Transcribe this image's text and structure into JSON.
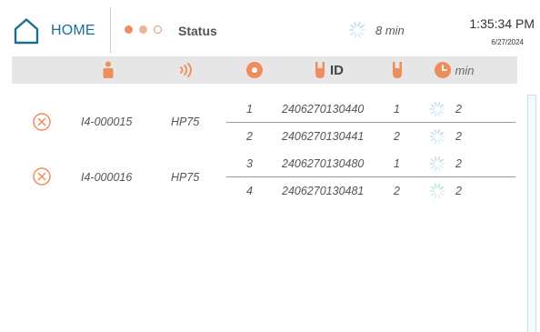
{
  "header": {
    "home_label": "HOME",
    "status_label": "Status",
    "status_dots": [
      "#ef8d5c",
      "#f2b394",
      "outline"
    ],
    "timer_text": "8 min",
    "clock_time": "1:35:34 PM",
    "clock_date": "6/27/2024"
  },
  "table_header": {
    "columns": [
      "person-icon",
      "rfid-signal-icon",
      "rack-position-icon",
      "tube-id-icon",
      "tube-icon",
      "clock-icon"
    ],
    "id_label": "ID",
    "min_label": "min"
  },
  "groups": [
    {
      "sample_id": "I4-000015",
      "rack": "HP75",
      "rows": [
        {
          "pos": "1",
          "tube_id": "2406270130440",
          "tube": "1",
          "min": "2"
        },
        {
          "pos": "2",
          "tube_id": "2406270130441",
          "tube": "2",
          "min": "2"
        }
      ]
    },
    {
      "sample_id": "I4-000016",
      "rack": "HP75",
      "rows": [
        {
          "pos": "3",
          "tube_id": "2406270130480",
          "tube": "1",
          "min": "2"
        },
        {
          "pos": "4",
          "tube_id": "2406270130481",
          "tube": "2",
          "min": "2"
        }
      ]
    }
  ],
  "colors": {
    "accent": "#ef8d5c",
    "home": "#1b6f8e",
    "header_bg": "#e6e6e6",
    "spinner": "#a9d8e8"
  }
}
